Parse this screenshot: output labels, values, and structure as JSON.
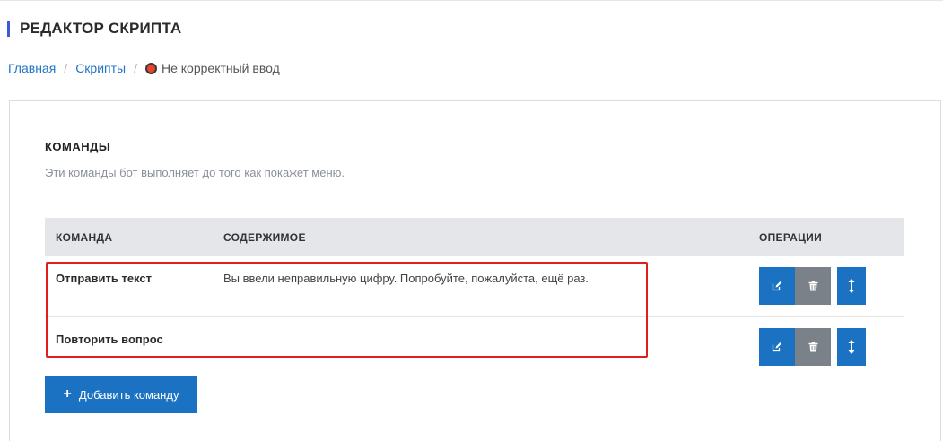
{
  "page": {
    "title": "РЕДАКТОР СКРИПТА"
  },
  "breadcrumb": {
    "items": [
      "Главная",
      "Скрипты"
    ],
    "separator": "/",
    "current": "Не корректный ввод",
    "current_icon": "stop-icon"
  },
  "commands": {
    "title": "КОМАНДЫ",
    "description": "Эти команды бот выполняет до того как покажет меню.",
    "table": {
      "headers": [
        "КОМАНДА",
        "СОДЕРЖИМОЕ",
        "ОПЕРАЦИИ"
      ],
      "rows": [
        {
          "command": "Отправить текст",
          "content": "Вы ввели неправильную цифру. Попробуйте, пожалуйста, ещё раз."
        },
        {
          "command": "Повторить вопрос",
          "content": ""
        }
      ],
      "operation_icons": [
        "edit-icon",
        "trash-icon",
        "move-vertical-icon"
      ]
    },
    "add_button": {
      "label": "Добавить команду",
      "icon": "plus-icon"
    }
  },
  "colors": {
    "accent": "#1c72c2",
    "title_accent": "#3d5bd6",
    "delete_button": "#7a8189",
    "highlight": "#e01e1e",
    "header_bg": "#e4e6ea"
  }
}
